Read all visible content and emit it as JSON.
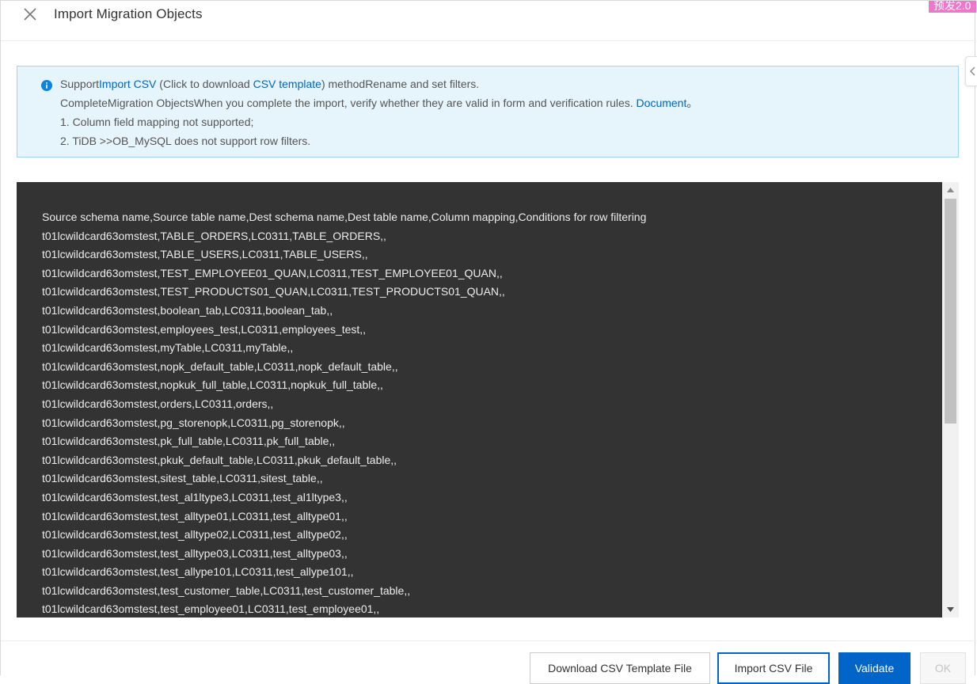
{
  "window": {
    "title": "Import Migration Objects",
    "env_badge": "预发2.0"
  },
  "notice": {
    "line1": {
      "before": "Support",
      "link1": "Import CSV",
      "middle": " (Click to download ",
      "link2": "CSV template",
      "after": ") methodRename and set filters."
    },
    "line2": {
      "before": "CompleteMigration ObjectsWhen you complete the import, verify whether they are valid in form and verification rules. ",
      "link": "Document",
      "after": "。"
    },
    "line3": "1. Column field mapping not supported;",
    "line4": "2. TiDB >>OB_MySQL does not support row filters."
  },
  "csv": {
    "lines": [
      "Source schema name,Source table name,Dest schema name,Dest table name,Column mapping,Conditions for row filtering",
      "t01lcwildcard63omstest,TABLE_ORDERS,LC0311,TABLE_ORDERS,,",
      "t01lcwildcard63omstest,TABLE_USERS,LC0311,TABLE_USERS,,",
      "t01lcwildcard63omstest,TEST_EMPLOYEE01_QUAN,LC0311,TEST_EMPLOYEE01_QUAN,,",
      "t01lcwildcard63omstest,TEST_PRODUCTS01_QUAN,LC0311,TEST_PRODUCTS01_QUAN,,",
      "t01lcwildcard63omstest,boolean_tab,LC0311,boolean_tab,,",
      "t01lcwildcard63omstest,employees_test,LC0311,employees_test,,",
      "t01lcwildcard63omstest,myTable,LC0311,myTable,,",
      "t01lcwildcard63omstest,nopk_default_table,LC0311,nopk_default_table,,",
      "t01lcwildcard63omstest,nopkuk_full_table,LC0311,nopkuk_full_table,,",
      "t01lcwildcard63omstest,orders,LC0311,orders,,",
      "t01lcwildcard63omstest,pg_storenopk,LC0311,pg_storenopk,,",
      "t01lcwildcard63omstest,pk_full_table,LC0311,pk_full_table,,",
      "t01lcwildcard63omstest,pkuk_default_table,LC0311,pkuk_default_table,,",
      "t01lcwildcard63omstest,sitest_table,LC0311,sitest_table,,",
      "t01lcwildcard63omstest,test_al1ltype3,LC0311,test_al1ltype3,,",
      "t01lcwildcard63omstest,test_alltype01,LC0311,test_alltype01,,",
      "t01lcwildcard63omstest,test_alltype02,LC0311,test_alltype02,,",
      "t01lcwildcard63omstest,test_alltype03,LC0311,test_alltype03,,",
      "t01lcwildcard63omstest,test_allype101,LC0311,test_allype101,,",
      "t01lcwildcard63omstest,test_customer_table,LC0311,test_customer_table,,",
      "t01lcwildcard63omstest,test_employee01,LC0311,test_employee01,,"
    ]
  },
  "footer": {
    "download_label": "Download CSV Template File",
    "import_label": "Import CSV File",
    "validate_label": "Validate",
    "ok_label": "OK"
  },
  "colors": {
    "accent": "#0064c8",
    "notice_bg": "#e6f5fc",
    "notice_border": "#9ed5f0",
    "editor_bg": "#333333",
    "badge": "#ee77cc"
  },
  "icons": {
    "close": "close-icon",
    "info": "info-icon",
    "collapse": "chevron-left-icon",
    "scroll_up": "arrow-up-icon",
    "scroll_down": "arrow-down-icon"
  }
}
